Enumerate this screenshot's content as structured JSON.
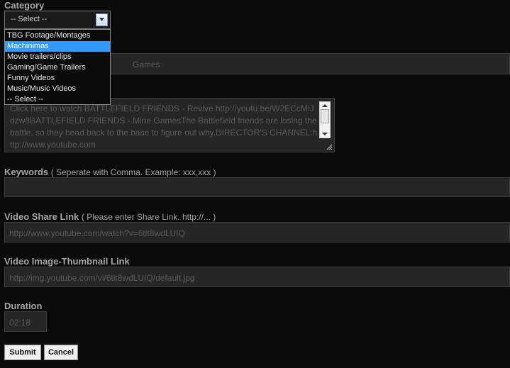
{
  "category": {
    "label": "Category",
    "selected_value": "-- Select --",
    "options": [
      "TBG Footage/Montages",
      "Machinimas",
      "Movie trailers/clips",
      "Gaming/Game Trailers",
      "Funny Videos",
      "Music/Music Videos",
      "-- Select --"
    ],
    "highlighted_option": "Machinimas"
  },
  "title_field": {
    "value": "Games"
  },
  "description": {
    "value": "Click here to watch BATTLEFIELD FRIENDS - Revive http://youtu.be/W2ECcMiJdzw8BATTLEFIELD FRIENDS - Mine GamesThe Battlefield friends are losing the battle, so they head back to the base to figure out why.DIRECTOR'S CHANNEL:http://www.youtube.com"
  },
  "keywords": {
    "label": "Keywords",
    "hint": "( Seperate with Comma. Example: xxx,xxx )",
    "value": ""
  },
  "share_link": {
    "label": "Video Share Link",
    "hint": "( Please enter Share Link. http://... )",
    "value": "http://www.youtube.com/watch?v=6tit8wdLUIQ"
  },
  "thumbnail_link": {
    "label": "Video Image-Thumbnail Link",
    "value": "http://img.youtube.com/vi/6tit8wdLUIQ/default.jpg"
  },
  "duration": {
    "label": "Duration",
    "value": "02:18"
  },
  "actions": {
    "submit_label": "Submit",
    "cancel_label": "Cancel"
  },
  "colors": {
    "background": "#0b0b0b",
    "field_background": "#262626",
    "label_text": "#a6a6a6",
    "field_text": "#5a5a5a",
    "highlight": "#3399ff"
  }
}
